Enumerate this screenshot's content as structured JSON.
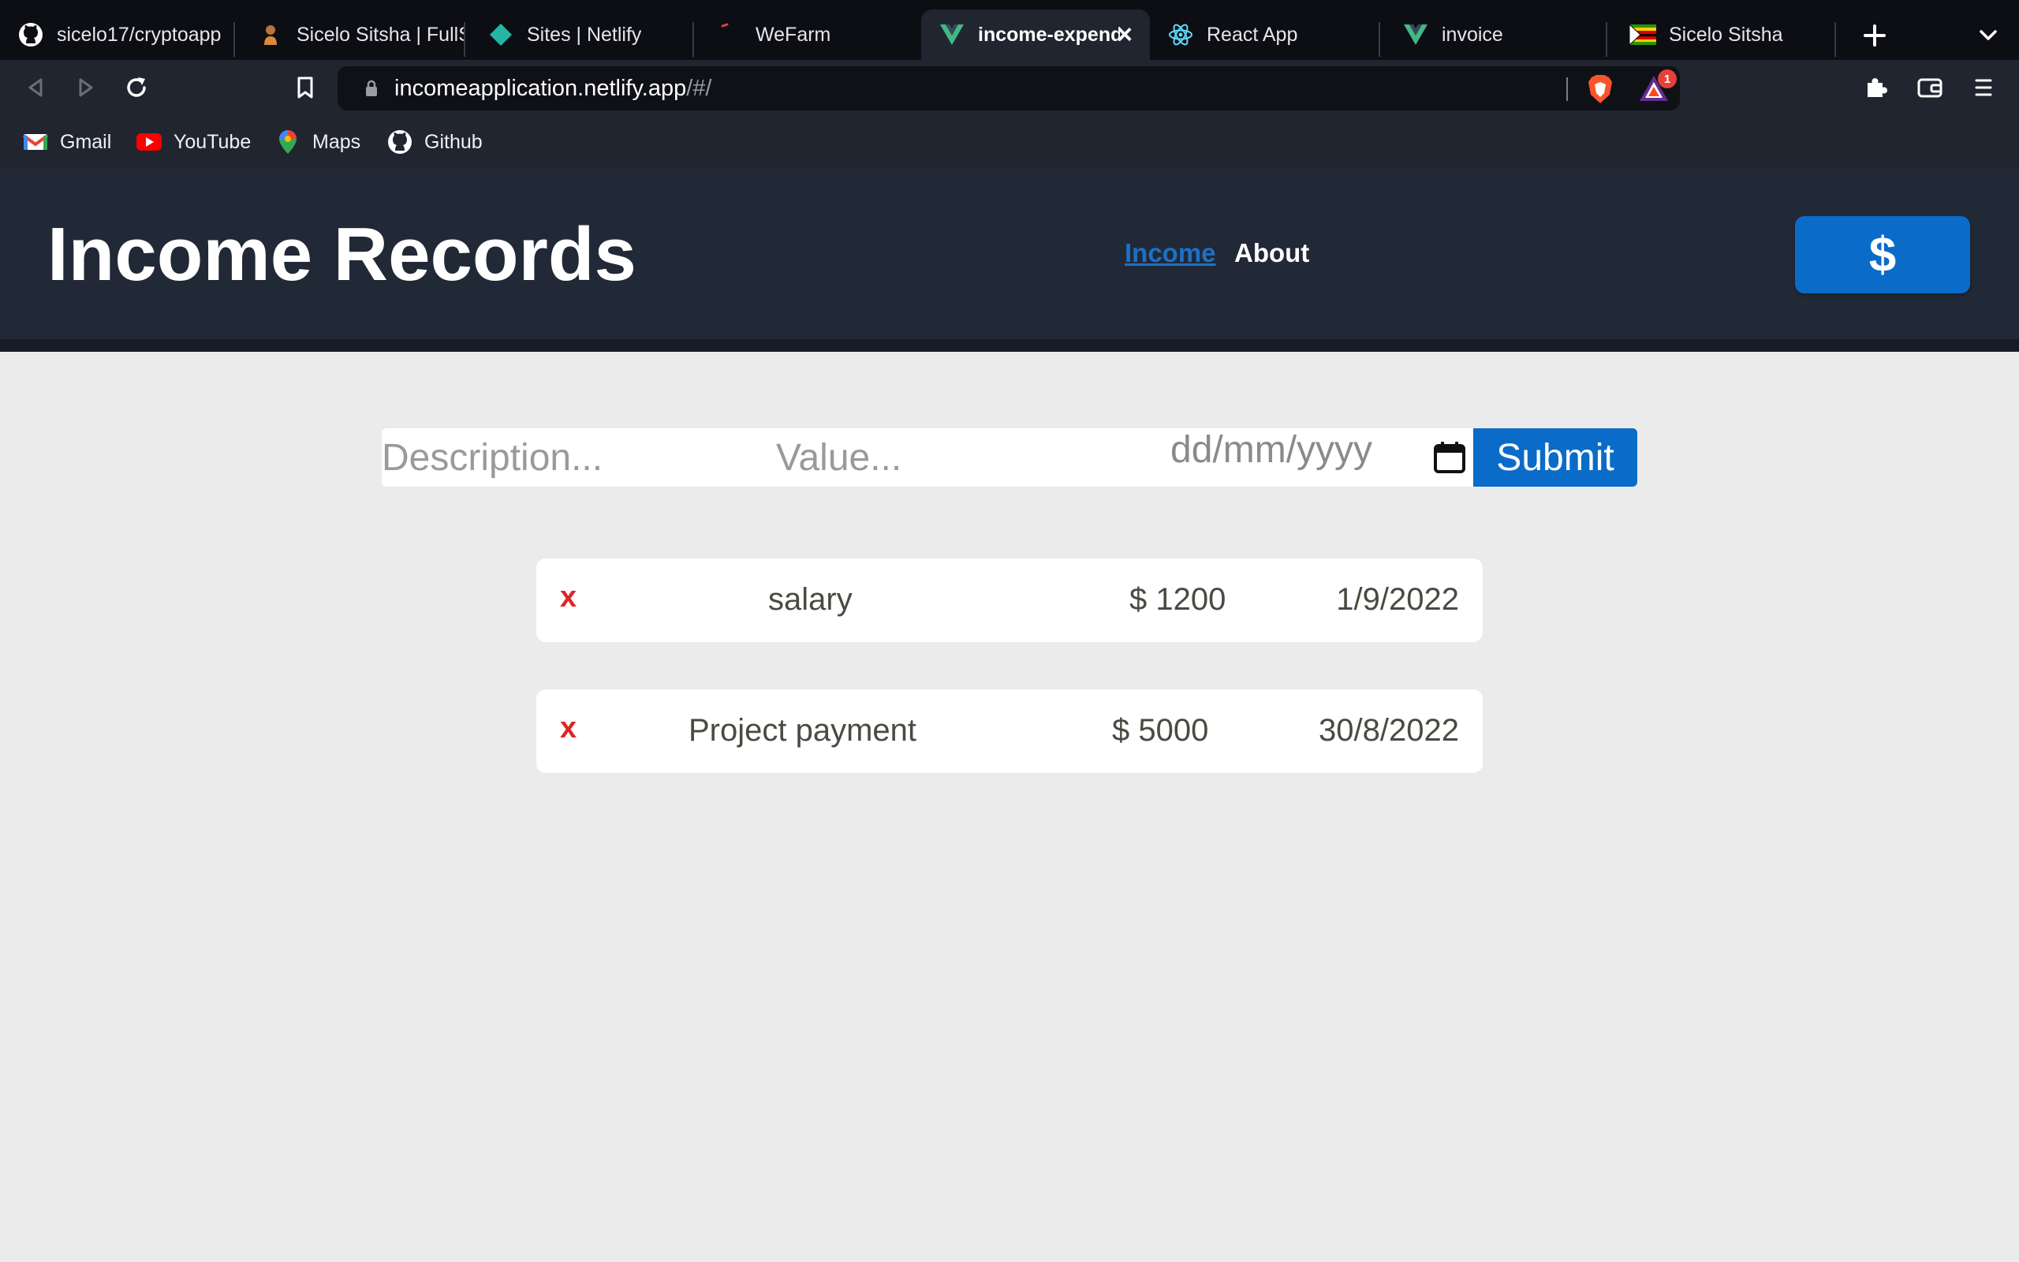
{
  "browser": {
    "tabs": [
      {
        "label": "sicelo17/cryptoapp",
        "icon": "github-icon"
      },
      {
        "label": "Sicelo Sitsha | FullS",
        "icon": "avatar-icon"
      },
      {
        "label": "Sites | Netlify",
        "icon": "netlify-icon"
      },
      {
        "label": "WeFarm",
        "icon": "wefarm-icon"
      },
      {
        "label": "income-expend",
        "icon": "vue-icon",
        "active": true
      },
      {
        "label": "React App",
        "icon": "react-icon"
      },
      {
        "label": "invoice",
        "icon": "vue-icon"
      },
      {
        "label": "Sicelo Sitsha",
        "icon": "zimbabwe-flag-icon"
      }
    ],
    "url_host": "incomeapplication.netlify.app",
    "url_path": "/#/",
    "rewards_badge": "1",
    "bookmarks": [
      {
        "label": "Gmail",
        "icon": "gmail-icon"
      },
      {
        "label": "YouTube",
        "icon": "youtube-icon"
      },
      {
        "label": "Maps",
        "icon": "maps-icon"
      },
      {
        "label": "Github",
        "icon": "github-icon"
      }
    ]
  },
  "app": {
    "title": "Income Records",
    "nav": {
      "income": "Income",
      "about": "About"
    },
    "currency_button": "$",
    "form": {
      "description_placeholder": "Description...",
      "value_placeholder": "Value...",
      "date_placeholder": "dd/mm/yyyy",
      "submit_label": "Submit"
    },
    "records": [
      {
        "delete_label": "x",
        "description": "salary",
        "value": "$ 1200",
        "date": "1/9/2022"
      },
      {
        "delete_label": "x",
        "description": "Project payment",
        "value": "$ 5000",
        "date": "30/8/2022"
      }
    ],
    "colors": {
      "header_bg": "#212937",
      "accent": "#0a6cc8",
      "delete": "#e02424",
      "page_bg": "#ebebeb"
    }
  }
}
